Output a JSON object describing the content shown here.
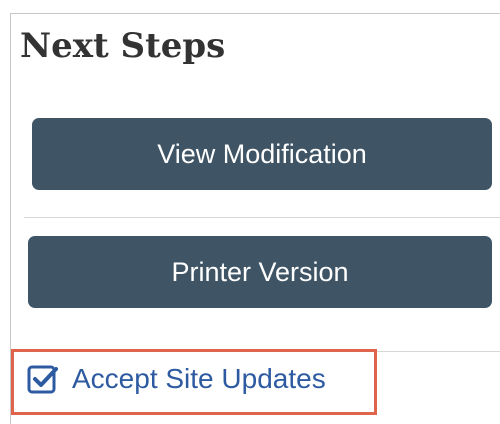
{
  "panel": {
    "title": "Next Steps"
  },
  "actions": {
    "view_modification_label": "View Modification",
    "printer_version_label": "Printer Version",
    "accept_site_updates_label": "Accept Site Updates"
  },
  "icons": {
    "accept_icon": "checkbox-check-icon"
  },
  "colors": {
    "button_bg": "#3f5566",
    "button_text": "#ffffff",
    "link_text": "#2d5aa0",
    "highlight_border": "#e0644b",
    "title_text": "#333333"
  }
}
